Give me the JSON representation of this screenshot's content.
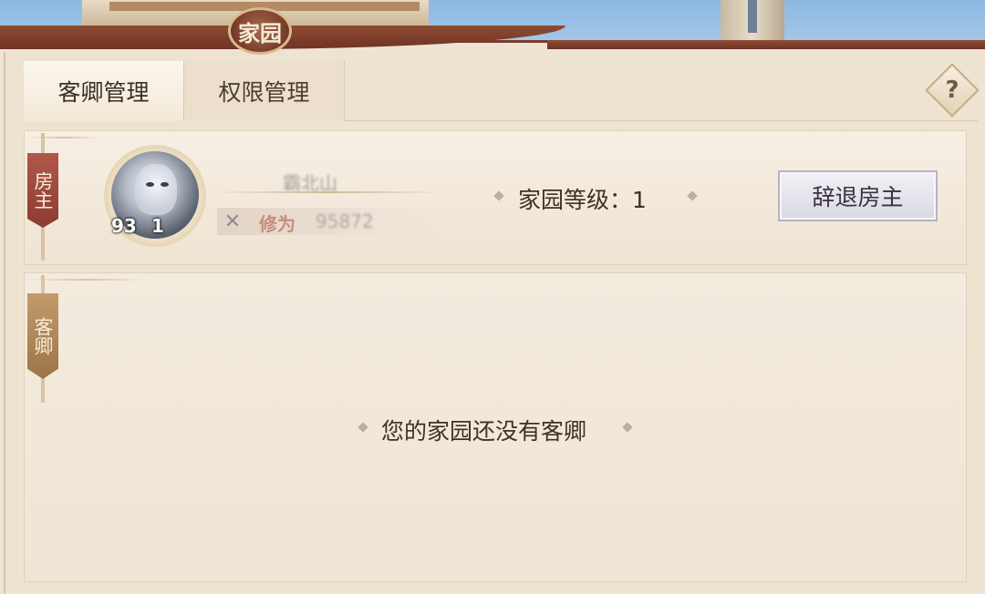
{
  "window": {
    "title": "家园"
  },
  "tabs": [
    {
      "label": "客卿管理",
      "active": true
    },
    {
      "label": "权限管理",
      "active": false
    }
  ],
  "help": {
    "label": "?"
  },
  "owner_section": {
    "banner": "房主",
    "player": {
      "avatar": "white-tiger-warrior",
      "level": "93",
      "rank": "1",
      "name": "霸北山",
      "cultivation_label": "修为",
      "cultivation_value": "95872",
      "cultivation_icon": "crossed-swords-icon"
    },
    "home_level_text": "家园等级：1",
    "dismiss_button": "辞退房主"
  },
  "guest_section": {
    "banner": "客卿",
    "empty_message": "您的家园还没有客卿"
  },
  "colors": {
    "roof": "#7c3f2b",
    "banner_owner": "#a04a3f",
    "banner_guest": "#b08a5a",
    "text": "#3e3228"
  }
}
